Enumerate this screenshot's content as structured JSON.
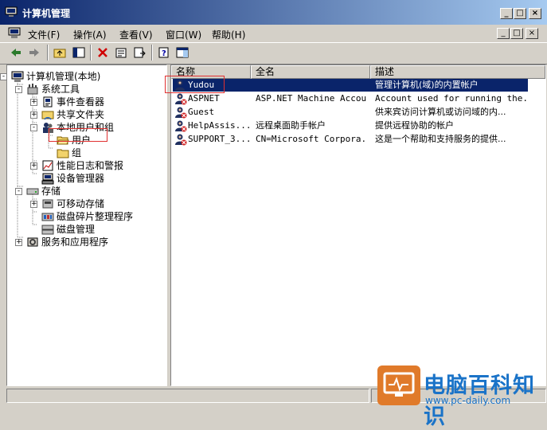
{
  "window": {
    "title": "计算机管理"
  },
  "caption_buttons": {
    "minimize": "_",
    "maximize": "□",
    "close": "×"
  },
  "menu": [
    {
      "label": "文件(F)"
    },
    {
      "label": "操作(A)"
    },
    {
      "label": "查看(V)"
    },
    {
      "label": "窗口(W)"
    },
    {
      "label": "帮助(H)"
    }
  ],
  "tree": [
    {
      "label": "计算机管理(本地)",
      "icon": "computer-icon",
      "expander": "-"
    },
    {
      "label": "系统工具",
      "icon": "tools-icon",
      "expander": "-"
    },
    {
      "label": "事件查看器",
      "icon": "event-viewer-icon",
      "expander": "+"
    },
    {
      "label": "共享文件夹",
      "icon": "shared-folder-icon",
      "expander": "+"
    },
    {
      "label": "本地用户和组",
      "icon": "users-groups-icon",
      "expander": "-"
    },
    {
      "label": "用户",
      "icon": "folder-open-icon",
      "expander": ""
    },
    {
      "label": "组",
      "icon": "folder-icon",
      "expander": ""
    },
    {
      "label": "性能日志和警报",
      "icon": "performance-icon",
      "expander": "+"
    },
    {
      "label": "设备管理器",
      "icon": "device-manager-icon",
      "expander": ""
    },
    {
      "label": "存储",
      "icon": "storage-icon",
      "expander": "-"
    },
    {
      "label": "可移动存储",
      "icon": "removable-storage-icon",
      "expander": "+"
    },
    {
      "label": "磁盘碎片整理程序",
      "icon": "defrag-icon",
      "expander": ""
    },
    {
      "label": "磁盘管理",
      "icon": "disk-management-icon",
      "expander": ""
    },
    {
      "label": "服务和应用程序",
      "icon": "services-icon",
      "expander": "+"
    }
  ],
  "columns": [
    {
      "label": "名称"
    },
    {
      "label": "全名"
    },
    {
      "label": "描述"
    }
  ],
  "rows": [
    {
      "name": "Yudou",
      "fullname": "",
      "desc": "管理计算机(域)的内置帐户",
      "selected": true
    },
    {
      "name": "ASPNET",
      "fullname": "ASP.NET Machine Account",
      "desc": "Account used for running the...",
      "selected": false
    },
    {
      "name": "Guest",
      "fullname": "",
      "desc": "供来宾访问计算机或访问域的内...",
      "selected": false
    },
    {
      "name": "HelpAssis...",
      "fullname": "远程桌面助手帐户",
      "desc": "提供远程协助的帐户",
      "selected": false
    },
    {
      "name": "SUPPORT_3...",
      "fullname": "CN=Microsoft Corpora...",
      "desc": "这是一个帮助和支持服务的提供...",
      "selected": false
    }
  ],
  "colors": {
    "selection": "#0a246a",
    "annotation": "#e03030"
  },
  "watermark": {
    "text": "电脑百科知识",
    "url": "www.pc-daily.com"
  }
}
